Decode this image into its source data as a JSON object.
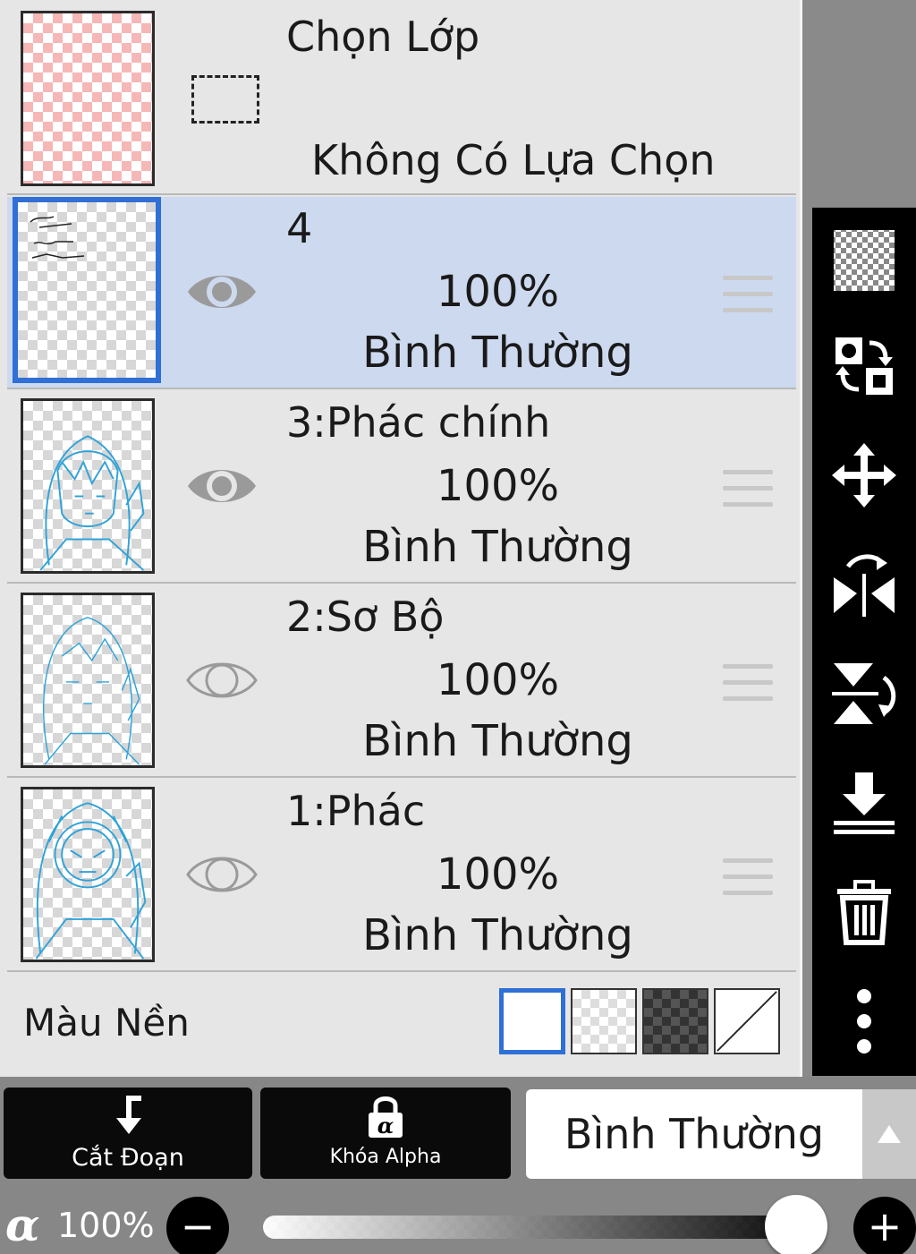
{
  "selection_row": {
    "title": "Chọn Lớp",
    "subtitle": "Không Có Lựa Chọn"
  },
  "layers": [
    {
      "name": "4",
      "opacity": "100%",
      "blend": "Bình Thường",
      "visible": true,
      "selected": true
    },
    {
      "name": "3:Phác chính",
      "opacity": "100%",
      "blend": "Bình Thường",
      "visible": true,
      "selected": false
    },
    {
      "name": "2:Sơ Bộ",
      "opacity": "100%",
      "blend": "Bình Thường",
      "visible": false,
      "selected": false
    },
    {
      "name": "1:Phác",
      "opacity": "100%",
      "blend": "Bình Thường",
      "visible": false,
      "selected": false
    }
  ],
  "background": {
    "label": "Màu Nền",
    "swatches": [
      "white",
      "transparent-light",
      "transparent-dark",
      "none"
    ],
    "selected": "white"
  },
  "toolbar_icons": [
    "checker-icon",
    "swap-layers-icon",
    "move-icon",
    "flip-horizontal-icon",
    "flip-vertical-icon",
    "merge-down-icon",
    "trash-icon",
    "more-icon"
  ],
  "bottom": {
    "clip_label": "Cắt Đoạn",
    "alpha_lock_label": "Khóa Alpha",
    "blend_mode": "Bình Thường",
    "alpha_symbol": "α",
    "alpha_value": "100%",
    "minus": "−",
    "plus": "+",
    "opacity_fraction": 1.0
  },
  "colors": {
    "selected_row": "#cdd9ef",
    "accent": "#2f6fd6",
    "sketch_blue": "#2fa3d9"
  }
}
